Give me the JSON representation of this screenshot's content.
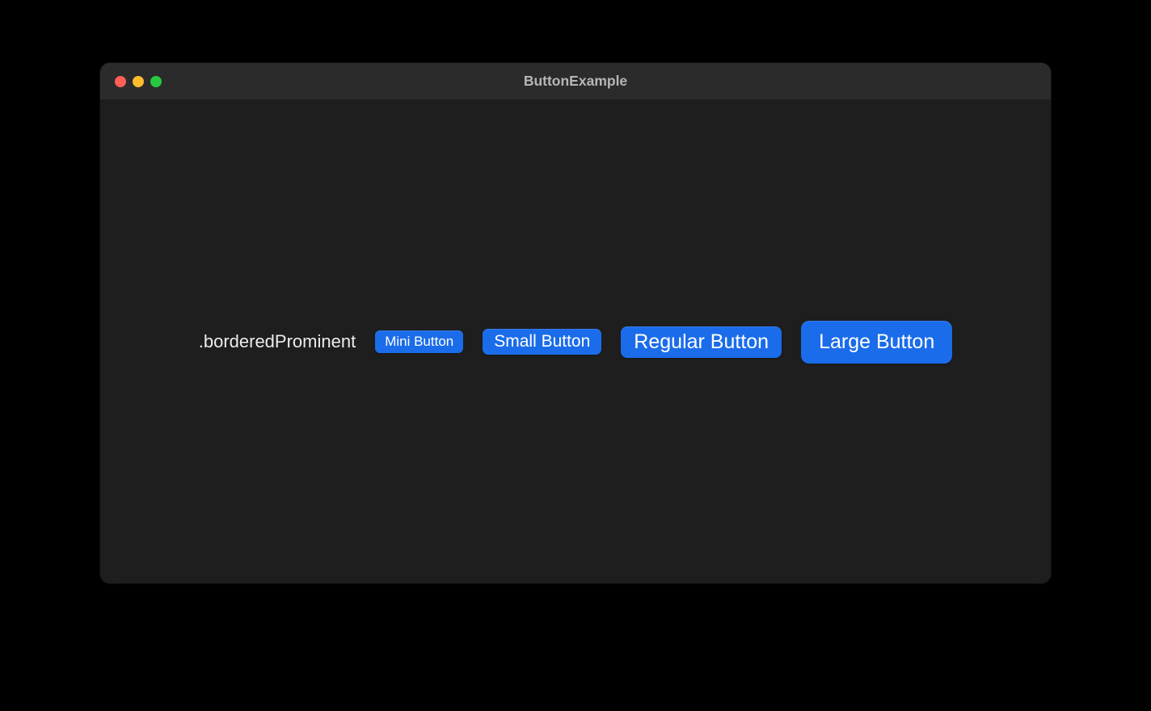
{
  "window": {
    "title": "ButtonExample"
  },
  "content": {
    "style_label": ".borderedProminent",
    "buttons": {
      "mini": "Mini Button",
      "small": "Small Button",
      "regular": "Regular Button",
      "large": "Large Button"
    }
  },
  "colors": {
    "accent": "#1a6cea",
    "window_bg": "#1e1e1e",
    "titlebar_bg": "#2b2b2b"
  }
}
